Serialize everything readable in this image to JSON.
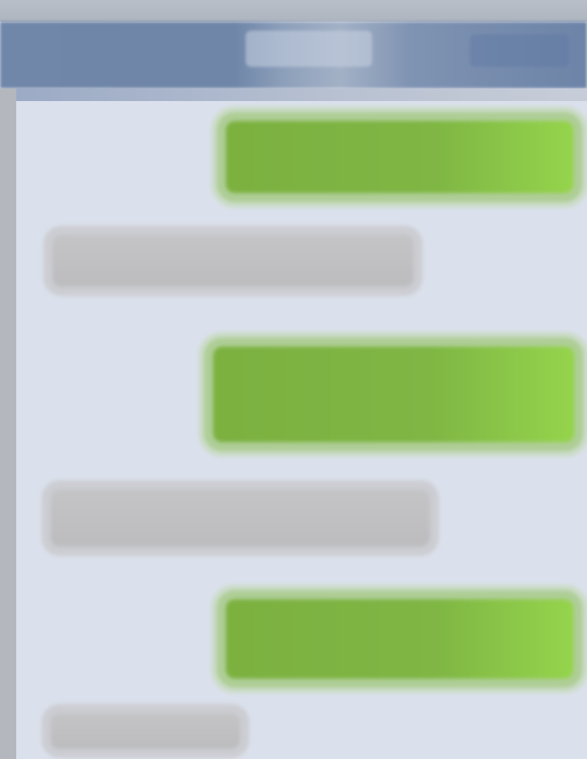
{
  "navbar": {
    "title": "",
    "edit_label": ""
  },
  "messages": [
    {
      "direction": "sent",
      "text": ""
    },
    {
      "direction": "received",
      "text": ""
    },
    {
      "direction": "sent",
      "text": ""
    },
    {
      "direction": "received",
      "text": ""
    },
    {
      "direction": "sent",
      "text": ""
    },
    {
      "direction": "received",
      "text": ""
    }
  ],
  "colors": {
    "sent_bubble": "#7fb644",
    "received_bubble": "#bfbfc2",
    "navbar": "#7187a9",
    "background": "#dbe1ec"
  }
}
